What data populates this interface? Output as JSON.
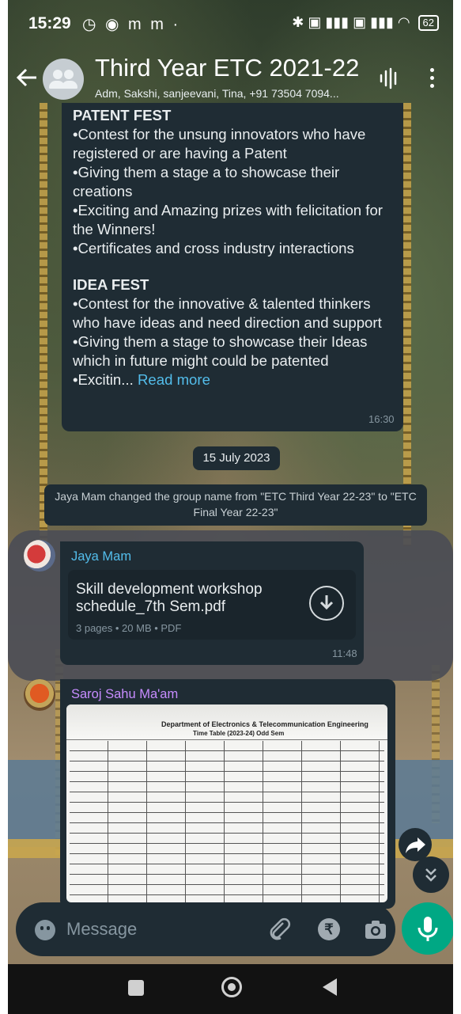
{
  "status": {
    "time": "15:29",
    "left_icons": "◷ ◉ m m ·",
    "right_icons": "✱ ▣ ▮▮▮ ▣ ▮▮▮ ◠",
    "battery": "62"
  },
  "header": {
    "title": "Third Year ETC 2021-22",
    "subtitle": "Adm, Sakshi, sanjeevani, Tina, +91 73504 7094..."
  },
  "message1": {
    "heading1": "PATENT FEST",
    "lines1": [
      "•Contest for the unsung innovators who have registered or are having a Patent",
      "•Giving them a stage a to showcase their creations",
      "•Exciting and Amazing prizes with felicitation for the Winners!",
      "•Certificates and cross industry interactions"
    ],
    "heading2": "IDEA FEST",
    "lines2": [
      "•Contest for the innovative & talented thinkers  who have ideas and need direction and support",
      "•Giving them a stage to showcase their Ideas which in future might could be patented"
    ],
    "truncated": "•Excitin...",
    "read_more": "Read more",
    "time": "16:30"
  },
  "date_chip": "15 July 2023",
  "system_message": "Jaya Mam changed the group name from \"ETC Third Year 22-23\" to \"ETC Final Year 22-23\"",
  "message2": {
    "sender": "Jaya Mam",
    "sender_color": "#53bdeb",
    "doc_name": "Skill development workshop schedule_7th Sem.pdf",
    "doc_meta": "3 pages • 20 MB • PDF",
    "time": "11:48"
  },
  "message3": {
    "sender": "Saroj Sahu Ma'am",
    "sender_color": "#c78cff",
    "image_title": "Department of Electronics & Telecommunication Engineering",
    "image_subtitle": "Time Table (2023-24) Odd Sem"
  },
  "composer": {
    "placeholder": "Message"
  },
  "colors": {
    "bubble": "#1f2c34",
    "accent": "#00a884",
    "link": "#53bdeb"
  }
}
